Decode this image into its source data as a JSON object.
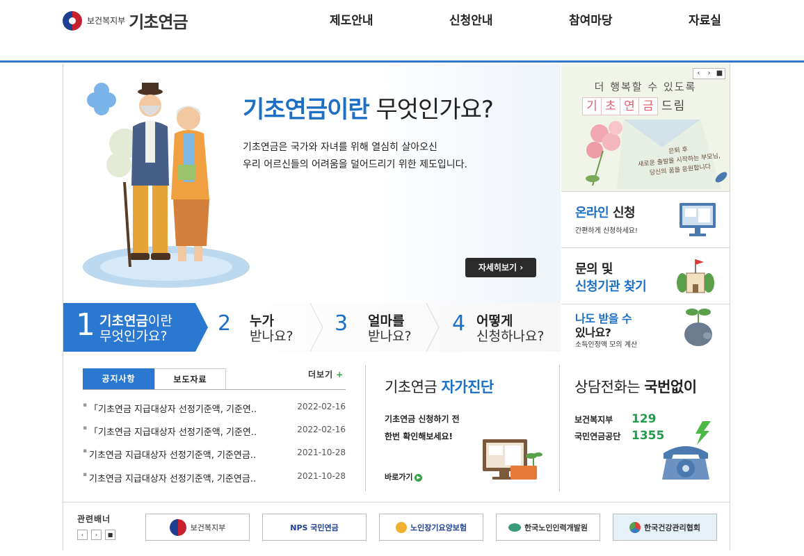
{
  "header": {
    "logo_ministry": "보건복지부",
    "logo_product": "기초연금",
    "nav": [
      "제도안내",
      "신청안내",
      "참여마당",
      "자료실"
    ]
  },
  "hero": {
    "title_highlight": "기초연금이란",
    "title_rest": " 무엇인가요?",
    "desc_line1": "기초연금은 국가와 자녀를 위해 열심히 살아오신",
    "desc_line2": "우리 어르신들의 어려움을 덜어드리기 위한 제도입니다.",
    "more_button": "자세히보기 ›"
  },
  "steps": [
    {
      "num": "1",
      "bold": "기초연금",
      "l1rest": "이란",
      "l2": "무엇인가요?"
    },
    {
      "num": "2",
      "bold": "누가",
      "l1rest": "",
      "l2": "받나요?"
    },
    {
      "num": "3",
      "bold": "얼마를",
      "l1rest": "",
      "l2": "받나요?"
    },
    {
      "num": "4",
      "bold": "어떻게",
      "l1rest": "",
      "l2": "신청하나요?"
    }
  ],
  "side_banner": {
    "controls": [
      "‹",
      "›",
      "■"
    ],
    "line1": "더 행복할 수 있도록",
    "chars": [
      "기",
      "초",
      "연",
      "금"
    ],
    "line2_tail": "드림",
    "note_l1": "은퇴 후",
    "note_l2": "새로운 출발을 시작하는 부모님,",
    "note_l3": "당신의 꿈을 응원합니다"
  },
  "side_boxes": {
    "online_hl": "온라인",
    "online_rest": " 신청",
    "online_sub": "간편하게 신청하세요!",
    "inquiry_l1": "문의 및",
    "inquiry_l2": "신청기관 찾기",
    "receive_l1": "나도 받을 수",
    "receive_l2": "있나요?",
    "receive_sub": "소득인정액 모의 계산"
  },
  "notice": {
    "tabs": [
      "공지사항",
      "보도자료"
    ],
    "more": "더보기",
    "more_icon": "+",
    "bullet": "▪",
    "items": [
      {
        "title": "「기초연금 지급대상자 선정기준액, 기준연..",
        "date": "2022-02-16"
      },
      {
        "title": " 「기초연금 지급대상자 선정기준액, 기준연..",
        "date": "2022-02-16"
      },
      {
        "title": "기초연금 지급대상자 선정기준액, 기준연금..",
        "date": "2021-10-28"
      },
      {
        "title": "기초연금 지급대상자 선정기준액, 기준연금..",
        "date": "2021-10-28"
      }
    ]
  },
  "diagnosis": {
    "title": "기초연금 ",
    "title_hl": "자가진단",
    "desc_l1": "기초연금 신청하기 전",
    "desc_l2": "한번 확인해보세요!",
    "go": "바로가기",
    "go_icon": "▶"
  },
  "call": {
    "title": "상담전화는 ",
    "title_bold": "국번없이",
    "rows": [
      {
        "org": "보건복지부",
        "no": "129"
      },
      {
        "org": "국민연금공단",
        "no": "1355"
      }
    ]
  },
  "related": {
    "title": "관련배너",
    "controls": [
      "‹",
      "›",
      "■"
    ],
    "banners": [
      "보건복지부",
      "NPS 국민연금",
      "노인장기요양보험",
      "한국노인인력개발원",
      "한국건강관리협회"
    ]
  },
  "colors": {
    "brand_blue": "#2a78d0",
    "accent_green": "#1f9d4a"
  }
}
